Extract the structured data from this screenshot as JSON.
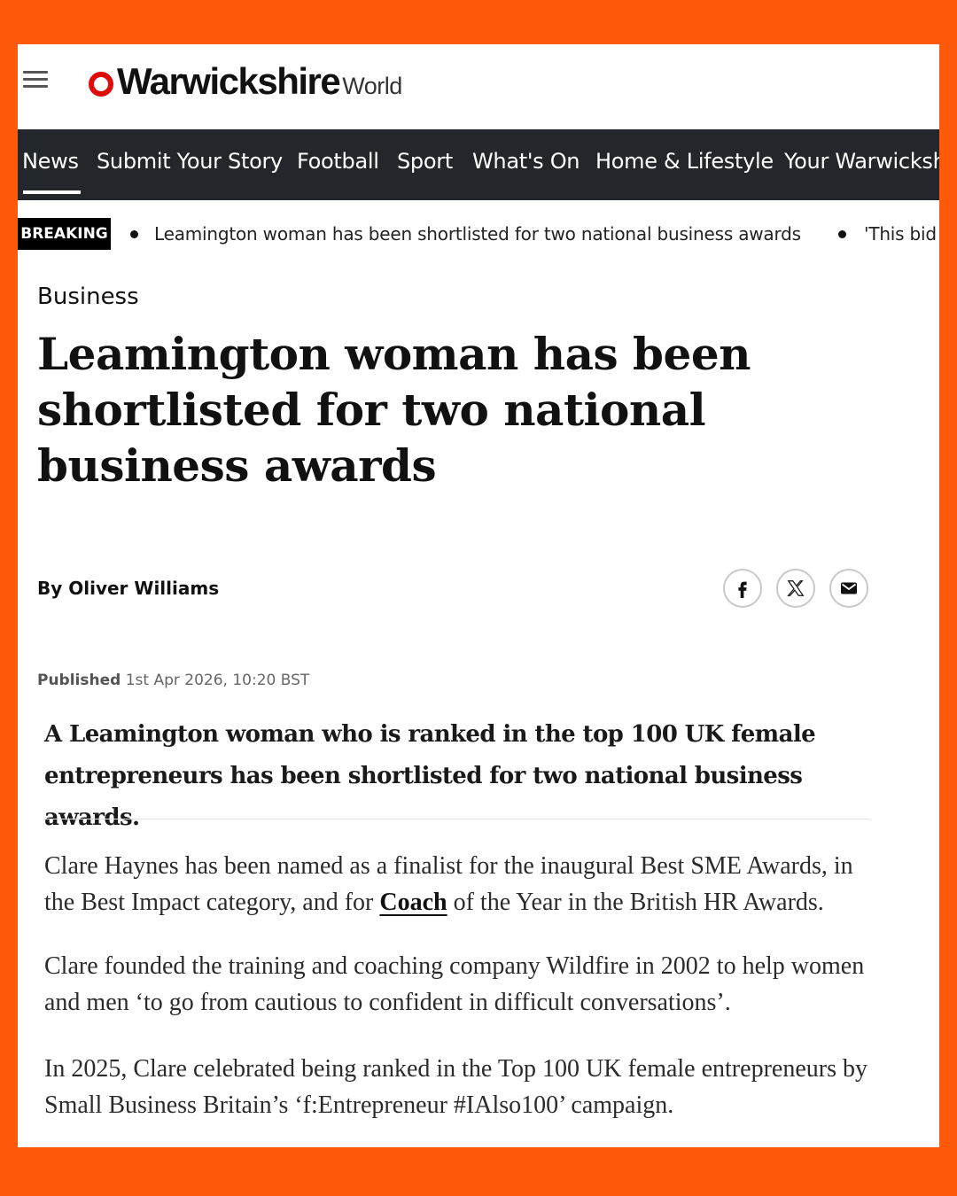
{
  "colors": {
    "frame": "#ff5a0a",
    "nav_bg": "#23272b",
    "logo_accent": "#e10a0a"
  },
  "header": {
    "logo_name": "Warwickshire",
    "logo_suffix": "World"
  },
  "nav": {
    "items": [
      "News",
      "Submit Your Story",
      "Football",
      "Sport",
      "What's On",
      "Home & Lifestyle",
      "Your Warwicksh"
    ]
  },
  "breaking": {
    "badge": "BREAKING",
    "items": [
      "Leamington woman has been shortlisted for two national business awards",
      "'This bid"
    ]
  },
  "article": {
    "section": "Business",
    "headline": "Leamington woman has been shortlisted for two national business awards",
    "byline": "By Oliver Williams",
    "share_icons": [
      "facebook-icon",
      "x-icon",
      "email-icon"
    ],
    "published_label": "Published",
    "published_date": "1st Apr 2026, 10:20 BST",
    "standfirst": "A Leamington woman who is ranked in the top 100 UK female entrepreneurs has been shortlisted for two national business awards.",
    "para1_before": "Clare Haynes has been named as a finalist for the inaugural Best SME Awards, in the Best Impact category, and for ",
    "para1_link": "Coach",
    "para1_after": " of the Year in the British HR Awards.",
    "para2": "Clare founded the training and coaching company Wildfire in 2002 to help women and men ‘to go from cautious to confident in difficult conversations’.",
    "para3": "In 2025, Clare celebrated being ranked in the Top 100 UK female entrepreneurs by Small Business Britain’s ‘f:Entrepreneur #IAlso100’ campaign."
  }
}
